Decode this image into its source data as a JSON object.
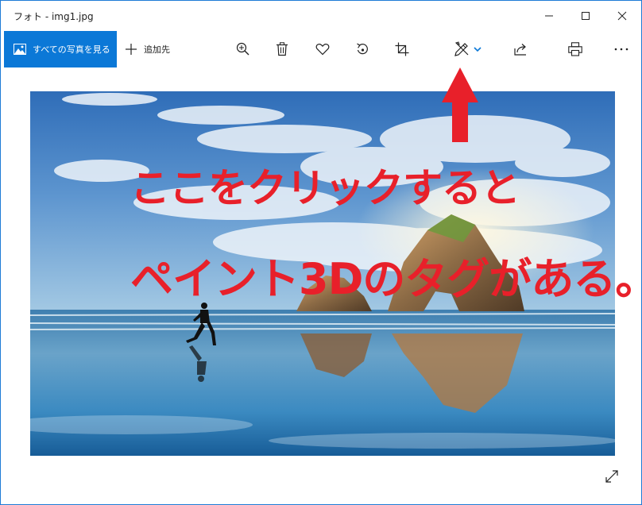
{
  "window": {
    "title": "フォト - img1.jpg"
  },
  "toolbar": {
    "see_all_label": "すべての写真を見る",
    "add_to_label": "追加先",
    "icons": [
      "zoom-in-icon",
      "trash-icon",
      "heart-icon",
      "rotate-icon",
      "crop-icon",
      "edit-create-icon",
      "chevron-down-icon",
      "share-icon",
      "print-icon",
      "more-icon"
    ]
  },
  "annotation": {
    "line1": "ここをクリックすると",
    "line2": "ペイント3Dのタグがある。"
  },
  "colors": {
    "accent": "#0b78d7",
    "annotation_red": "#e8202a",
    "window_border": "#1e7bd6"
  }
}
